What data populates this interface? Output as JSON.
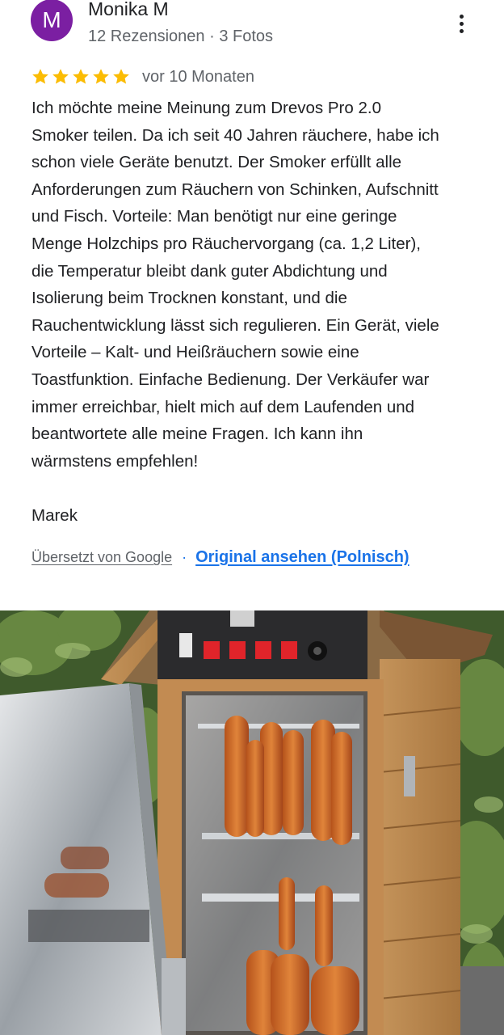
{
  "reviewer": {
    "initial": "M",
    "name": "Monika M",
    "meta": "12 Rezensionen · 3 Fotos",
    "avatar_color": "#7b1fa2"
  },
  "rating": {
    "stars": 5,
    "max": 5,
    "star_color": "#fbbc04",
    "date": "vor 10 Monaten"
  },
  "review_text": "Ich möchte meine Meinung zum Drevos Pro 2.0\nSmoker teilen. Da ich seit 40 Jahren räuchere, habe ich\nschon viele Geräte benutzt. Der Smoker erfüllt alle\nAnforderungen zum Räuchern von Schinken, Aufschnitt\nund Fisch. Vorteile: Man benötigt nur eine geringe\nMenge Holzchips pro Räuchervorgang (ca. 1,2 Liter),\ndie Temperatur bleibt dank guter Abdichtung und\nIsolierung beim Trocknen konstant, und die\nRauchentwicklung lässt sich regulieren. Ein Gerät, viele\nVorteile – Kalt- und Heißräuchern sowie eine\nToastfunktion. Einfache Bedienung. Der Verkäufer war\nimmer erreichbar, hielt mich auf dem Laufenden und\nbeantwortete alle meine Fragen. Ich kann ihn\nwärmstens empfehlen!\n\nMarek",
  "translation": {
    "translated_label": "Übersetzt von Google",
    "separator": "·",
    "original_link": "Original ansehen (Polnisch)",
    "link_color": "#1a73e8"
  },
  "icons": {
    "menu": "more-vert-icon",
    "star": "star-icon"
  },
  "photo": {
    "subject": "smoker-photo"
  }
}
